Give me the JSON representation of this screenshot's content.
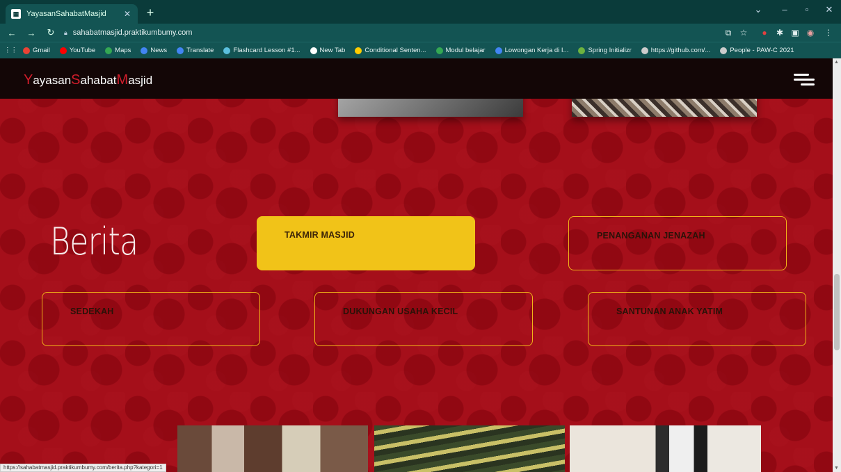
{
  "browser": {
    "tab_title": "YayasanSahabatMasjid",
    "url": "sahabatmasjid.praktikumbumy.com",
    "status_url": "https://sahabatmasjid.praktikumbumy.com/berita.php?kategori=1",
    "bookmarks": [
      {
        "label": "Gmail",
        "color": "#ea4335"
      },
      {
        "label": "YouTube",
        "color": "#ff0000"
      },
      {
        "label": "Maps",
        "color": "#34a853"
      },
      {
        "label": "News",
        "color": "#4285f4"
      },
      {
        "label": "Translate",
        "color": "#4285f4"
      },
      {
        "label": "Flashcard Lesson #1...",
        "color": "#5bc0de"
      },
      {
        "label": "New Tab",
        "color": "#ffffff"
      },
      {
        "label": "Conditional Senten...",
        "color": "#ffcc00"
      },
      {
        "label": "Modul belajar",
        "color": "#34a853"
      },
      {
        "label": "Lowongan Kerja di I...",
        "color": "#4285f4"
      },
      {
        "label": "Spring Initializr",
        "color": "#6db33f"
      },
      {
        "label": "https://github.com/...",
        "color": "#cccccc"
      },
      {
        "label": "People - PAW-C 2021",
        "color": "#cccccc"
      }
    ]
  },
  "site": {
    "brand": {
      "cap1": "Y",
      "part1": "ayasan",
      "cap2": "S",
      "part2": "ahabat",
      "cap3": "M",
      "part3": "asjid"
    },
    "heading": "Berita",
    "categories": [
      {
        "label": "TAKMIR MASJID",
        "active": true
      },
      {
        "label": "PENANGANAN JENAZAH",
        "active": false
      },
      {
        "label": "SEDEKAH",
        "active": false
      },
      {
        "label": "DUKUNGAN USAHA KECIL",
        "active": false
      },
      {
        "label": "SANTUNAN ANAK YATIM",
        "active": false
      }
    ]
  },
  "colors": {
    "accent_yellow": "#f1c318",
    "background_red": "#a50f1a",
    "brand_red": "#d21d2b",
    "navbar": "#130606"
  }
}
